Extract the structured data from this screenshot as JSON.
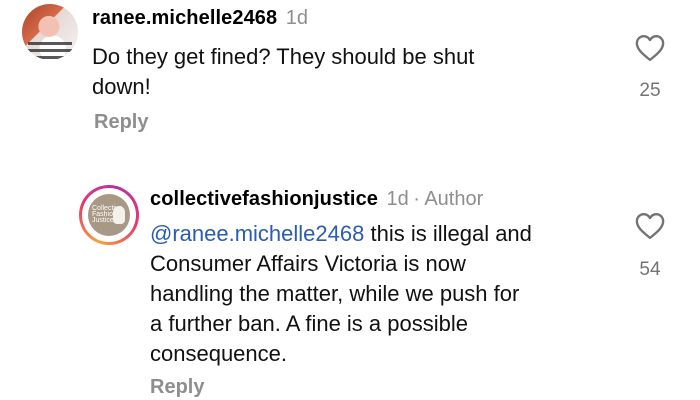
{
  "comments": [
    {
      "username": "ranee.michelle2468",
      "time": "1d",
      "text_lines": [
        "Do they get fined? They should be shut",
        "down!"
      ],
      "likes": "25",
      "reply_label": "Reply"
    },
    {
      "username": "collectivefashionjustice",
      "time": "1d",
      "separator": "·",
      "author_badge": "Author",
      "mention": "@ranee.michelle2468",
      "first_line_rest": " this is illegal and",
      "text_lines": [
        "Consumer Affairs Victoria is now",
        "handling the matter, while we push for",
        "a further ban. A fine is a possible",
        "consequence."
      ],
      "likes": "54",
      "reply_label": "Reply",
      "avatar_logo_lines": [
        "Collective",
        "Fashion",
        "Justice"
      ]
    }
  ]
}
